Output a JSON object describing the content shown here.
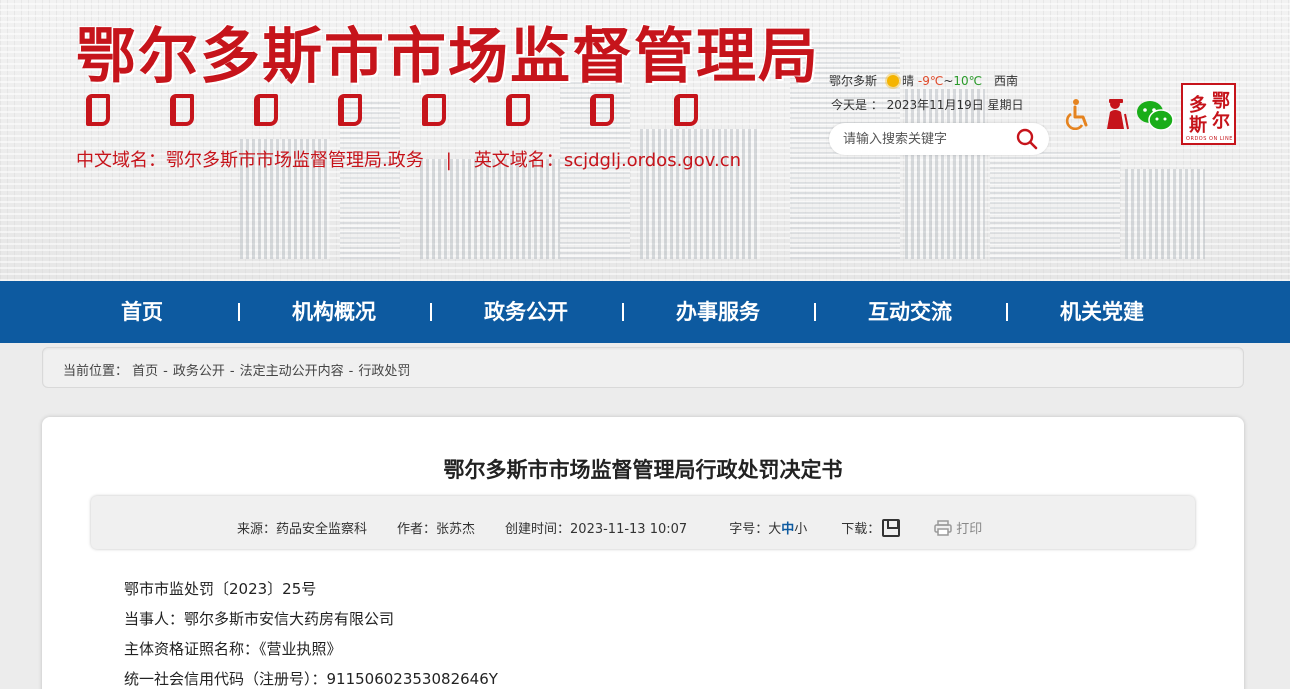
{
  "header": {
    "site_title": "鄂尔多斯市市场监督管理局",
    "domain_cn_label": "中文域名：",
    "domain_cn": "鄂尔多斯市市场监督管理局.政务",
    "domain_sep": "|",
    "domain_en_label": "英文域名：",
    "domain_en": "scjdglj.ordos.gov.cn",
    "weather": {
      "city": "鄂尔多斯",
      "condition": "晴",
      "low": "-9℃",
      "tilde": "~",
      "high": "10℃",
      "wind": "西南"
    },
    "today": "今天是 ： 2023年11月19日 星期日",
    "search_placeholder": "请输入搜索关键字",
    "icons": [
      "accessibility-icon",
      "elder-mode-icon",
      "wechat-icon",
      "ordos-online-logo"
    ],
    "logo": {
      "chars": [
        "鄂",
        "尔",
        "多",
        "斯"
      ],
      "tagline": "ORDOS ON LINE"
    }
  },
  "nav": {
    "items": [
      "首页",
      "机构概况",
      "政务公开",
      "办事服务",
      "互动交流",
      "机关党建"
    ]
  },
  "breadcrumb": {
    "label": "当前位置：",
    "items": [
      "首页",
      "政务公开",
      "法定主动公开内容",
      "行政处罚"
    ],
    "sep": "-"
  },
  "article": {
    "title": "鄂尔多斯市市场监督管理局行政处罚决定书",
    "meta": {
      "source": "来源：药品安全监察科",
      "author": "作者：张苏杰",
      "created": "创建时间：2023-11-13 10:07",
      "font_label": "字号：",
      "font_large": "大",
      "font_mid": "中",
      "font_small": "小",
      "download": "下载：",
      "print": "打印"
    },
    "lines": [
      "鄂市市监处罚〔2023〕25号",
      "当事人：鄂尔多斯市安信大药房有限公司",
      "主体资格证照名称：《营业执照》",
      "统一社会信用代码（注册号）：91150602353082646Y"
    ]
  },
  "colors": {
    "brand_red": "#c6141b",
    "nav_blue": "#0d5aa0",
    "low_temp": "#e04a2a",
    "high_temp": "#2a9a2a"
  }
}
